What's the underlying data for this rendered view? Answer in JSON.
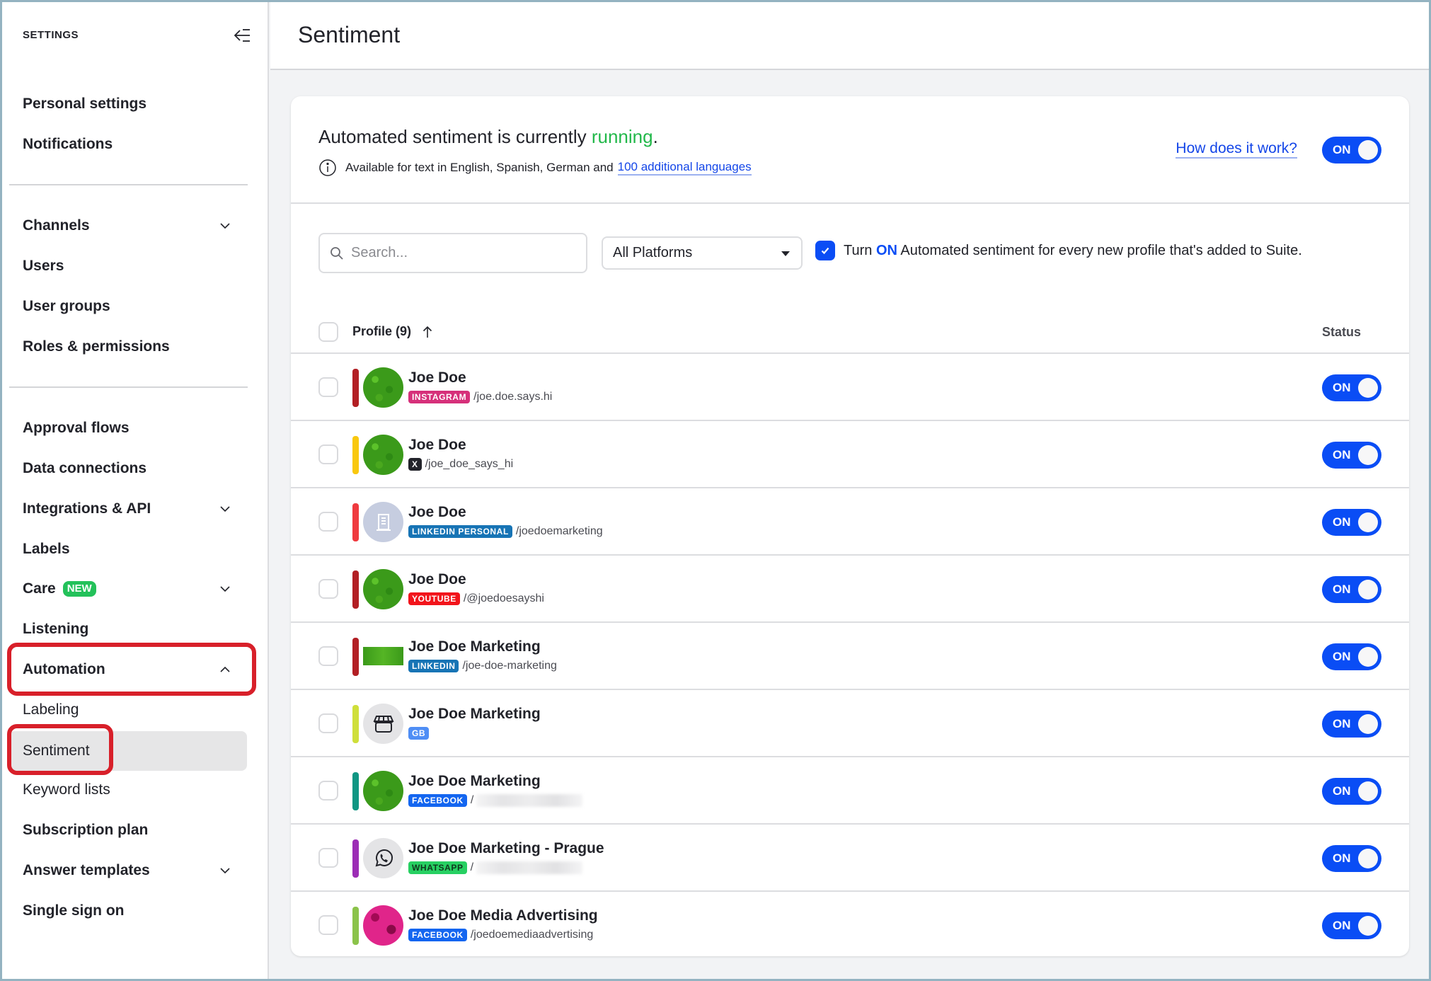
{
  "sidebar": {
    "heading": "SETTINGS",
    "collapse_icon": "collapse-sidebar-icon",
    "items": [
      {
        "label": "Personal settings"
      },
      {
        "label": "Notifications"
      },
      {
        "label": "Channels",
        "expandable": true
      },
      {
        "label": "Users"
      },
      {
        "label": "User groups"
      },
      {
        "label": "Roles & permissions"
      },
      {
        "label": "Approval flows"
      },
      {
        "label": "Data connections"
      },
      {
        "label": "Integrations & API",
        "expandable": true
      },
      {
        "label": "Labels"
      },
      {
        "label": "Care",
        "badge": "NEW",
        "expandable": true
      },
      {
        "label": "Listening"
      },
      {
        "label": "Automation",
        "expanded": true
      },
      {
        "label": "Labeling",
        "sub": true
      },
      {
        "label": "Sentiment",
        "sub": true,
        "active": true
      },
      {
        "label": "Keyword lists",
        "sub": true
      },
      {
        "label": "Subscription plan"
      },
      {
        "label": "Answer templates",
        "expandable": true
      },
      {
        "label": "Single sign on"
      }
    ]
  },
  "header": {
    "title": "Sentiment"
  },
  "status": {
    "prefix": "Automated sentiment is currently ",
    "state": "running",
    "suffix": ".",
    "info_text": "Available for text in English, Spanish, German and",
    "info_link": "100 additional languages",
    "help_link": "How does it work?",
    "master_toggle": "ON"
  },
  "filters": {
    "search_placeholder": "Search...",
    "search_value": "",
    "platform_selected": "All Platforms",
    "auto_checkbox_checked": true,
    "auto_prefix": "Turn ",
    "auto_on": "ON",
    "auto_suffix": " Automated sentiment for every new profile that's added to Suite."
  },
  "table": {
    "profile_header": "Profile (9)",
    "status_header": "Status",
    "rows": [
      {
        "name": "Joe Doe",
        "network": "INSTAGRAM",
        "handle": "/joe.doe.says.hi",
        "accent": "#b21f24",
        "badge_color": "#d6307a",
        "avatar": "moss",
        "status": "ON"
      },
      {
        "name": "Joe Doe",
        "network": "X",
        "handle": "/joe_doe_says_hi",
        "accent": "#f9c80e",
        "badge_color": "#22232a",
        "avatar": "moss",
        "status": "ON"
      },
      {
        "name": "Joe Doe",
        "network": "LINKEDIN PERSONAL",
        "handle": "/joedoemarketing",
        "accent": "#ef3a3f",
        "badge_color": "#1774b5",
        "avatar": "building",
        "status": "ON"
      },
      {
        "name": "Joe Doe",
        "network": "YOUTUBE",
        "handle": "/@joedoesayshi",
        "accent": "#b21f24",
        "badge_color": "#f2141b",
        "avatar": "moss",
        "status": "ON"
      },
      {
        "name": "Joe Doe Marketing",
        "network": "LINKEDIN",
        "handle": "/joe-doe-marketing",
        "accent": "#b21f24",
        "badge_color": "#1774b5",
        "avatar": "moss-rect",
        "status": "ON"
      },
      {
        "name": "Joe Doe Marketing",
        "network": "GB",
        "handle": "",
        "accent": "#cfdf3a",
        "badge_color": "#4f8ef5",
        "avatar": "store",
        "status": "ON"
      },
      {
        "name": "Joe Doe Marketing",
        "network": "FACEBOOK",
        "handle": "/",
        "handle_blurred": true,
        "accent": "#0f9683",
        "badge_color": "#1466f0",
        "avatar": "moss",
        "status": "ON"
      },
      {
        "name": "Joe Doe Marketing - Prague",
        "network": "WHATSAPP",
        "handle": "/",
        "handle_blurred": true,
        "accent": "#9c2db5",
        "badge_color": "#27d062",
        "badge_text_color": "#10381e",
        "avatar": "whatsapp",
        "status": "ON"
      },
      {
        "name": "Joe Doe Media Advertising",
        "network": "FACEBOOK",
        "handle": "/joedoemediaadvertising",
        "accent": "#8bc34a",
        "badge_color": "#1466f0",
        "avatar": "roses",
        "status": "ON"
      }
    ]
  },
  "colors": {
    "accent_blue": "#0a4df5",
    "running_green": "#22b84a",
    "annotation_red": "#d8202a"
  }
}
